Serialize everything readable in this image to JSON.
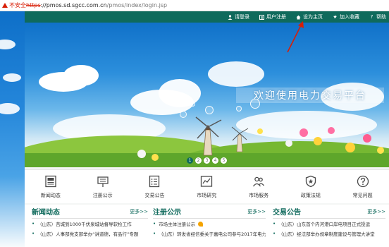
{
  "browser": {
    "insecure_label": "不安全",
    "proto_struck": "https",
    "host": "pmos.sd.sgcc.com.cn",
    "path": "/pmos/index/login.jsp"
  },
  "topnav": {
    "items": [
      {
        "label": "请登录",
        "icon": "user-icon"
      },
      {
        "label": "用户注册",
        "icon": "register-icon"
      },
      {
        "label": "设为主页",
        "icon": "home-icon"
      },
      {
        "label": "加入收藏",
        "icon": "star-icon"
      },
      {
        "label": "帮助",
        "icon": "help-icon"
      }
    ]
  },
  "banner": {
    "slogan": "欢迎使用电力交易平台",
    "pager": [
      "1",
      "2",
      "3",
      "4",
      "5"
    ]
  },
  "icons": [
    {
      "label": "新闻动态",
      "icon": "news-icon"
    },
    {
      "label": "注册公示",
      "icon": "register-notice-icon"
    },
    {
      "label": "交易公告",
      "icon": "announcement-icon"
    },
    {
      "label": "市场研究",
      "icon": "research-icon"
    },
    {
      "label": "市场服务",
      "icon": "service-icon"
    },
    {
      "label": "政策法规",
      "icon": "policy-icon"
    },
    {
      "label": "常见问题",
      "icon": "faq-icon"
    }
  ],
  "columns": {
    "news": {
      "title": "新闻动态",
      "more": "更多>>",
      "items": [
        "（山东）莒城到1000千伏泉城站督导软检工作",
        "（山东）人事部党支部举办“讲道德，有品行”专题"
      ]
    },
    "registration": {
      "title": "注册公示",
      "more": "更多>>",
      "items": [
        "市场主体注册公示",
        "（山东）转发省经信委关于嘉电公司参与2017年电力"
      ]
    },
    "trade": {
      "title": "交易公告",
      "more": "更多>>",
      "items": [
        "（山东）山东首个内河港口岸电项目正式投运",
        "（山东）经法部举办规章制度建设与管理大讲堂"
      ]
    }
  },
  "colors": {
    "brand": "#0f6a5c",
    "sky": "#1071c9",
    "grass": "#76b832",
    "annotation": "#d81e06"
  }
}
